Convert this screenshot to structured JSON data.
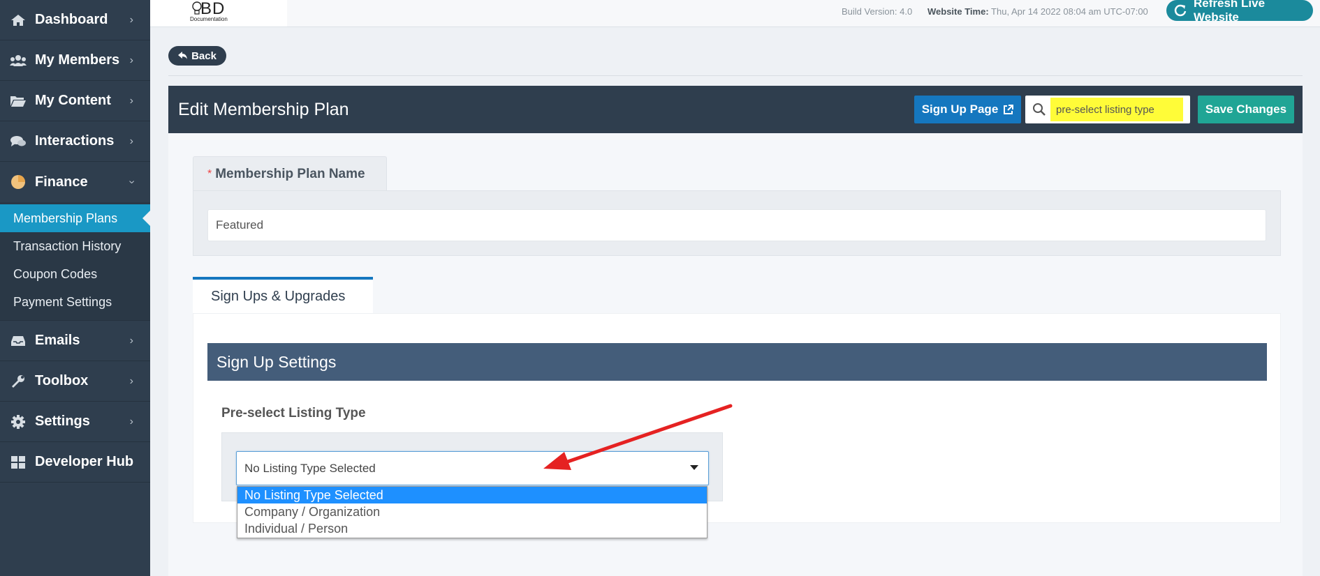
{
  "sidebar": {
    "items": [
      {
        "label": "Dashboard",
        "icon": "home-icon"
      },
      {
        "label": "My Members",
        "icon": "users-icon"
      },
      {
        "label": "My Content",
        "icon": "folder-icon"
      },
      {
        "label": "Interactions",
        "icon": "comments-icon"
      },
      {
        "label": "Finance",
        "icon": "pie-chart-icon"
      },
      {
        "label": "Emails",
        "icon": "inbox-icon"
      },
      {
        "label": "Toolbox",
        "icon": "wrench-icon"
      },
      {
        "label": "Settings",
        "icon": "gear-icon"
      },
      {
        "label": "Developer Hub",
        "icon": "grid-icon"
      }
    ],
    "finance_sub": [
      "Membership Plans",
      "Transaction History",
      "Coupon Codes",
      "Payment Settings"
    ]
  },
  "topbar": {
    "logo_text": "BD",
    "logo_sub": "Documentation",
    "build": "Build Version: 4.0",
    "website_time_label": "Website Time:",
    "website_time_value": "Thu, Apr 14 2022 08:04 am UTC-07:00",
    "refresh_label": "Refresh Live Website"
  },
  "back_label": "Back",
  "header": {
    "title": "Edit Membership Plan",
    "signup_label": "Sign Up Page",
    "search_value": "pre-select listing type",
    "save_label": "Save Changes"
  },
  "plan_name": {
    "required_mark": "*",
    "label": "Membership Plan Name",
    "value": "Featured"
  },
  "tab_label": "Sign Ups & Upgrades",
  "section_title": "Sign Up Settings",
  "listing_type": {
    "label": "Pre-select Listing Type",
    "selected": "No Listing Type Selected",
    "options": [
      "No Listing Type Selected",
      "Company / Organization",
      "Individual / Person"
    ]
  },
  "colors": {
    "sidebar": "#2f3e4e",
    "active": "#1a98c5",
    "signup": "#1577bf",
    "save": "#20a595",
    "highlight": "#fffc38",
    "arrow": "#e52222"
  }
}
